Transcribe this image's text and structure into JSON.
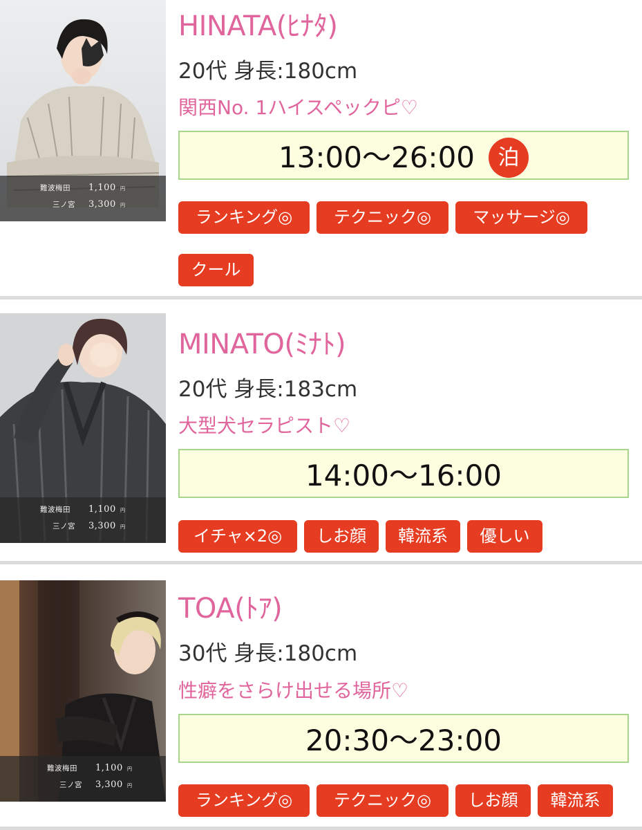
{
  "prices": {
    "row1_label": "難波梅田",
    "row1_value": "1,100",
    "row2_label": "三ノ宮",
    "row2_value": "3,300",
    "unit": "円"
  },
  "therapists": [
    {
      "name": "HINATA(ﾋﾅﾀ)",
      "info": "20代 身長:180cm",
      "catch": "関西No. 1ハイスペックピ♡",
      "time": "13:00〜26:00",
      "badge": "泊",
      "tags": [
        "ランキング◎",
        "テクニック◎",
        "マッサージ◎",
        "クール"
      ]
    },
    {
      "name": "MINATO(ﾐﾅﾄ)",
      "info": "20代 身長:183cm",
      "catch": "大型犬セラピスト♡",
      "time": "14:00〜16:00",
      "tags": [
        "イチャ×2◎",
        "しお顔",
        "韓流系",
        "優しい"
      ]
    },
    {
      "name": "TOA(ﾄｱ)",
      "info": "30代 身長:180cm",
      "catch": "性癖をさらけ出せる場所♡",
      "time": "20:30〜23:00",
      "tags": [
        "ランキング◎",
        "テクニック◎",
        "しお顔",
        "韓流系"
      ]
    }
  ],
  "colors": {
    "name": "#e0659c",
    "tag": "#e53c22",
    "schedule_bg": "#fdfee0",
    "schedule_border": "#a9d58a"
  }
}
